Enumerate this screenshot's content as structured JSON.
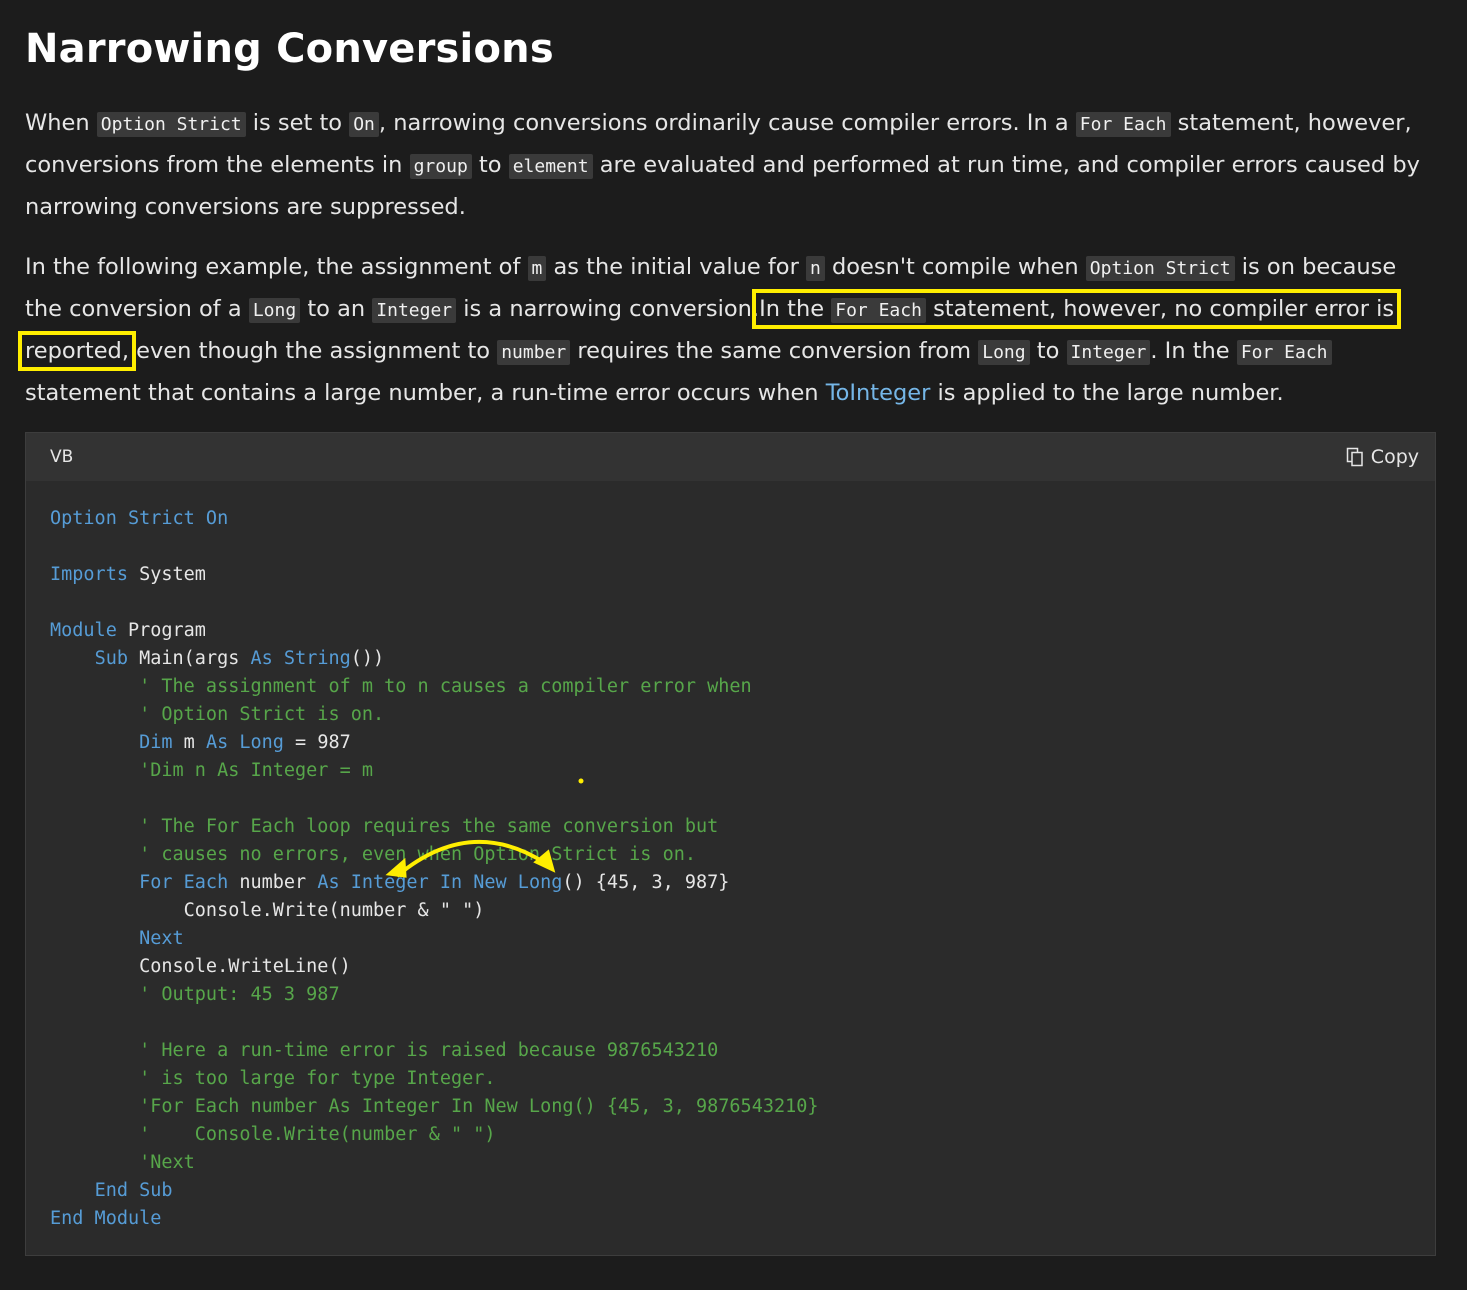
{
  "heading": "Narrowing Conversions",
  "p1": {
    "t0": "When ",
    "c0": "Option Strict",
    "t1": " is set to ",
    "c1": "On",
    "t2": ", narrowing conversions ordinarily cause compiler errors. In a ",
    "c2": "For Each",
    "t3": " statement, however, conversions from the elements in ",
    "c3": "group",
    "t4": " to ",
    "c4": "element",
    "t5": " are evaluated and performed at run time, and compiler errors caused by narrowing conversions are suppressed."
  },
  "p2": {
    "t0": "In the following example, the assignment of ",
    "c0": "m",
    "t1": " as the initial value for ",
    "c1": "n",
    "t2": " doesn't compile when ",
    "c2": "Option Strict",
    "t3": " is on because the conversion of a ",
    "c3": "Long",
    "t4": " to an ",
    "c4": "Integer",
    "t5": " is a narrowing conversion.",
    "h0": "In the ",
    "hc": "For Each",
    "h1": " statement, however, no compiler error is reported,",
    "t6": " even though the assignment to ",
    "c5": "number",
    "t7": " requires the same conversion from ",
    "c6": "Long",
    "t8": " to ",
    "c7": "Integer",
    "t9": ". In the ",
    "c8": "For Each",
    "t10": " statement that contains a large number, a run-time error occurs when ",
    "link": "ToInteger",
    "t11": " is applied to the large number."
  },
  "code_block": {
    "language": "VB",
    "copy_label": "Copy",
    "lines": [
      [
        {
          "k": "kw",
          "t": "Option Strict On"
        }
      ],
      [],
      [
        {
          "k": "kw",
          "t": "Imports"
        },
        {
          "k": "",
          "t": " System"
        }
      ],
      [],
      [
        {
          "k": "kw",
          "t": "Module"
        },
        {
          "k": "",
          "t": " Program"
        }
      ],
      [
        {
          "k": "",
          "t": "    "
        },
        {
          "k": "kw",
          "t": "Sub"
        },
        {
          "k": "",
          "t": " Main(args "
        },
        {
          "k": "kw",
          "t": "As String"
        },
        {
          "k": "",
          "t": "())"
        }
      ],
      [
        {
          "k": "cm",
          "t": "        ' The assignment of m to n causes a compiler error when"
        }
      ],
      [
        {
          "k": "cm",
          "t": "        ' Option Strict is on."
        }
      ],
      [
        {
          "k": "",
          "t": "        "
        },
        {
          "k": "kw",
          "t": "Dim"
        },
        {
          "k": "",
          "t": " m "
        },
        {
          "k": "kw",
          "t": "As Long"
        },
        {
          "k": "",
          "t": " = 987"
        }
      ],
      [
        {
          "k": "cm",
          "t": "        'Dim n As Integer = m"
        }
      ],
      [],
      [
        {
          "k": "cm",
          "t": "        ' The For Each loop requires the same conversion but"
        }
      ],
      [
        {
          "k": "cm",
          "t": "        ' causes no errors, even when Option Strict is on."
        }
      ],
      [
        {
          "k": "",
          "t": "        "
        },
        {
          "k": "kw",
          "t": "For Each"
        },
        {
          "k": "",
          "t": " number "
        },
        {
          "k": "kw",
          "t": "As Integer In New Long"
        },
        {
          "k": "",
          "t": "() {45, 3, 987}"
        }
      ],
      [
        {
          "k": "",
          "t": "            Console.Write(number & \" \")"
        }
      ],
      [
        {
          "k": "",
          "t": "        "
        },
        {
          "k": "kw",
          "t": "Next"
        }
      ],
      [
        {
          "k": "",
          "t": "        Console.WriteLine()"
        }
      ],
      [
        {
          "k": "cm",
          "t": "        ' Output: 45 3 987"
        }
      ],
      [],
      [
        {
          "k": "cm",
          "t": "        ' Here a run-time error is raised because 9876543210"
        }
      ],
      [
        {
          "k": "cm",
          "t": "        ' is too large for type Integer."
        }
      ],
      [
        {
          "k": "cm",
          "t": "        'For Each number As Integer In New Long() {45, 3, 9876543210}"
        }
      ],
      [
        {
          "k": "cm",
          "t": "        '    Console.Write(number & \" \")"
        }
      ],
      [
        {
          "k": "cm",
          "t": "        'Next"
        }
      ],
      [
        {
          "k": "",
          "t": "    "
        },
        {
          "k": "kw",
          "t": "End Sub"
        }
      ],
      [
        {
          "k": "kw",
          "t": "End Module"
        }
      ]
    ]
  },
  "colors": {
    "background": "#1c1c1c",
    "keyword": "#569cd6",
    "comment": "#57a64a",
    "highlight": "#ffee00",
    "link": "#75b6e7"
  }
}
